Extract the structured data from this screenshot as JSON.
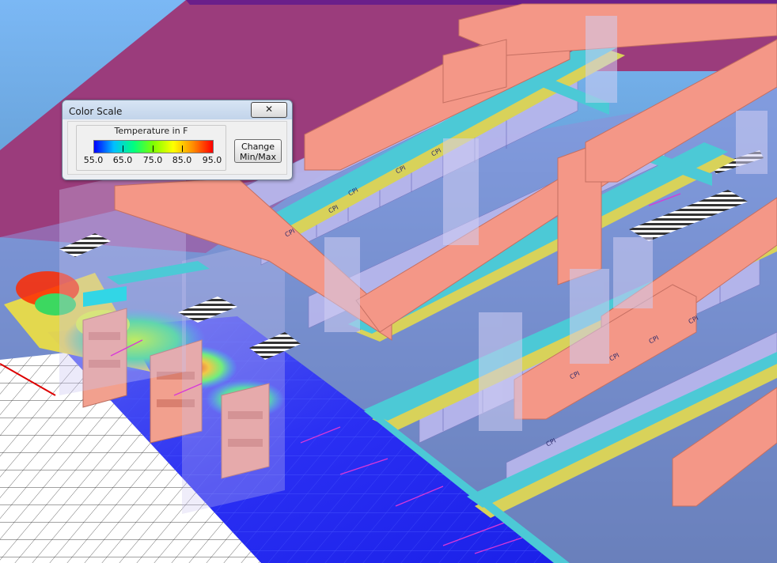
{
  "dialog": {
    "title": "Color Scale",
    "close_symbol": "x-icon",
    "close_glyph": "✕",
    "scale_title": "Temperature in F",
    "ticks": [
      "55.0",
      "65.0",
      "75.0",
      "85.0",
      "95.0"
    ],
    "change_button": "Change\nMin/Max"
  },
  "scene": {
    "cabinet_label": "CPI"
  },
  "colors": {
    "duct": "#f39685",
    "tray": "#4cc9d6",
    "tray_edge": "#d8d25a",
    "floor_blue": "#2a31f2",
    "cabinet": "#b9b9e8",
    "wall_magenta": "#9a3a7a"
  }
}
